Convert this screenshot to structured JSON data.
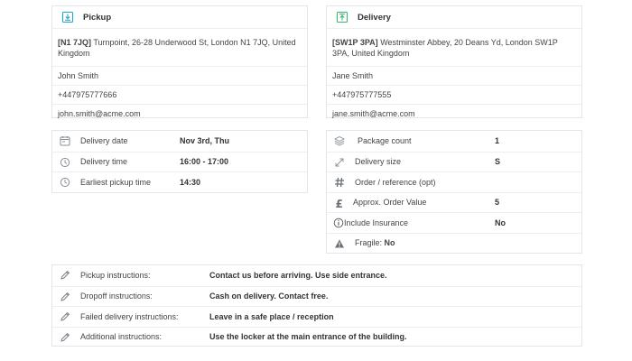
{
  "pickup": {
    "title": "Pickup",
    "postcode": "[N1 7JQ]",
    "address": " Turnpoint, 26-28 Underwood St, London N1 7JQ, United Kingdom",
    "name": "John Smith",
    "phone": "+447975777666",
    "email": "john.smith@acme.com"
  },
  "delivery": {
    "title": "Delivery",
    "postcode": "[SW1P 3PA]",
    "address": " Westminster Abbey, 20 Deans Yd, London SW1P 3PA, United Kingdom",
    "name": "Jane Smith",
    "phone": "+447975777555",
    "email": "jane.smith@acme.com"
  },
  "schedule": [
    {
      "icon": "calendar-icon",
      "label": "Delivery date",
      "value": "Nov 3rd, Thu"
    },
    {
      "icon": "clock-icon",
      "label": "Delivery time",
      "value": "16:00 - 17:00"
    },
    {
      "icon": "clock-icon",
      "label": "Earliest pickup time",
      "value": "14:30"
    }
  ],
  "package": [
    {
      "icon": "boxes-icon",
      "label": "Package count",
      "value": "1"
    },
    {
      "icon": "resize-icon",
      "label": "Delivery size",
      "value": "S"
    },
    {
      "icon": "hash-icon",
      "label": "Order / reference (opt)",
      "value": ""
    },
    {
      "icon": "pound-icon",
      "label": "Approx. Order Value",
      "value": "5"
    },
    {
      "icon": "info-icon",
      "label": "Include Insurance",
      "value": "No"
    }
  ],
  "fragile": {
    "label": "Fragile:",
    "value": "No"
  },
  "instructions": [
    {
      "label": "Pickup instructions:",
      "value": "Contact us before arriving. Use side entrance."
    },
    {
      "label": "Dropoff instructions:",
      "value": "Cash on delivery. Contact free."
    },
    {
      "label": "Failed delivery instructions:",
      "value": "Leave in a safe place / reception"
    },
    {
      "label": "Additional instructions:",
      "value": "Use the locker at the main entrance of the building."
    }
  ],
  "colors": {
    "accent": "#1fa7c9",
    "green": "#3cb371",
    "icon_grey": "#8a8f96",
    "border": "#e3e5e8"
  }
}
